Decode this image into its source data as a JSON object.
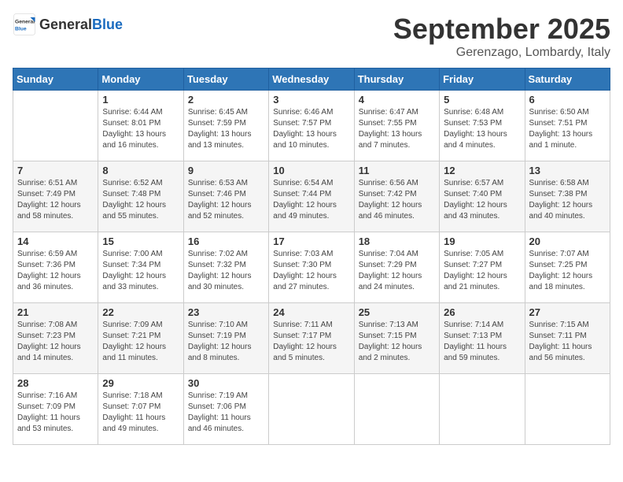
{
  "logo": {
    "general": "General",
    "blue": "Blue"
  },
  "title": "September 2025",
  "location": "Gerenzago, Lombardy, Italy",
  "weekdays": [
    "Sunday",
    "Monday",
    "Tuesday",
    "Wednesday",
    "Thursday",
    "Friday",
    "Saturday"
  ],
  "weeks": [
    [
      {
        "day": "",
        "sunrise": "",
        "sunset": "",
        "daylight": ""
      },
      {
        "day": "1",
        "sunrise": "Sunrise: 6:44 AM",
        "sunset": "Sunset: 8:01 PM",
        "daylight": "Daylight: 13 hours and 16 minutes."
      },
      {
        "day": "2",
        "sunrise": "Sunrise: 6:45 AM",
        "sunset": "Sunset: 7:59 PM",
        "daylight": "Daylight: 13 hours and 13 minutes."
      },
      {
        "day": "3",
        "sunrise": "Sunrise: 6:46 AM",
        "sunset": "Sunset: 7:57 PM",
        "daylight": "Daylight: 13 hours and 10 minutes."
      },
      {
        "day": "4",
        "sunrise": "Sunrise: 6:47 AM",
        "sunset": "Sunset: 7:55 PM",
        "daylight": "Daylight: 13 hours and 7 minutes."
      },
      {
        "day": "5",
        "sunrise": "Sunrise: 6:48 AM",
        "sunset": "Sunset: 7:53 PM",
        "daylight": "Daylight: 13 hours and 4 minutes."
      },
      {
        "day": "6",
        "sunrise": "Sunrise: 6:50 AM",
        "sunset": "Sunset: 7:51 PM",
        "daylight": "Daylight: 13 hours and 1 minute."
      }
    ],
    [
      {
        "day": "7",
        "sunrise": "Sunrise: 6:51 AM",
        "sunset": "Sunset: 7:49 PM",
        "daylight": "Daylight: 12 hours and 58 minutes."
      },
      {
        "day": "8",
        "sunrise": "Sunrise: 6:52 AM",
        "sunset": "Sunset: 7:48 PM",
        "daylight": "Daylight: 12 hours and 55 minutes."
      },
      {
        "day": "9",
        "sunrise": "Sunrise: 6:53 AM",
        "sunset": "Sunset: 7:46 PM",
        "daylight": "Daylight: 12 hours and 52 minutes."
      },
      {
        "day": "10",
        "sunrise": "Sunrise: 6:54 AM",
        "sunset": "Sunset: 7:44 PM",
        "daylight": "Daylight: 12 hours and 49 minutes."
      },
      {
        "day": "11",
        "sunrise": "Sunrise: 6:56 AM",
        "sunset": "Sunset: 7:42 PM",
        "daylight": "Daylight: 12 hours and 46 minutes."
      },
      {
        "day": "12",
        "sunrise": "Sunrise: 6:57 AM",
        "sunset": "Sunset: 7:40 PM",
        "daylight": "Daylight: 12 hours and 43 minutes."
      },
      {
        "day": "13",
        "sunrise": "Sunrise: 6:58 AM",
        "sunset": "Sunset: 7:38 PM",
        "daylight": "Daylight: 12 hours and 40 minutes."
      }
    ],
    [
      {
        "day": "14",
        "sunrise": "Sunrise: 6:59 AM",
        "sunset": "Sunset: 7:36 PM",
        "daylight": "Daylight: 12 hours and 36 minutes."
      },
      {
        "day": "15",
        "sunrise": "Sunrise: 7:00 AM",
        "sunset": "Sunset: 7:34 PM",
        "daylight": "Daylight: 12 hours and 33 minutes."
      },
      {
        "day": "16",
        "sunrise": "Sunrise: 7:02 AM",
        "sunset": "Sunset: 7:32 PM",
        "daylight": "Daylight: 12 hours and 30 minutes."
      },
      {
        "day": "17",
        "sunrise": "Sunrise: 7:03 AM",
        "sunset": "Sunset: 7:30 PM",
        "daylight": "Daylight: 12 hours and 27 minutes."
      },
      {
        "day": "18",
        "sunrise": "Sunrise: 7:04 AM",
        "sunset": "Sunset: 7:29 PM",
        "daylight": "Daylight: 12 hours and 24 minutes."
      },
      {
        "day": "19",
        "sunrise": "Sunrise: 7:05 AM",
        "sunset": "Sunset: 7:27 PM",
        "daylight": "Daylight: 12 hours and 21 minutes."
      },
      {
        "day": "20",
        "sunrise": "Sunrise: 7:07 AM",
        "sunset": "Sunset: 7:25 PM",
        "daylight": "Daylight: 12 hours and 18 minutes."
      }
    ],
    [
      {
        "day": "21",
        "sunrise": "Sunrise: 7:08 AM",
        "sunset": "Sunset: 7:23 PM",
        "daylight": "Daylight: 12 hours and 14 minutes."
      },
      {
        "day": "22",
        "sunrise": "Sunrise: 7:09 AM",
        "sunset": "Sunset: 7:21 PM",
        "daylight": "Daylight: 12 hours and 11 minutes."
      },
      {
        "day": "23",
        "sunrise": "Sunrise: 7:10 AM",
        "sunset": "Sunset: 7:19 PM",
        "daylight": "Daylight: 12 hours and 8 minutes."
      },
      {
        "day": "24",
        "sunrise": "Sunrise: 7:11 AM",
        "sunset": "Sunset: 7:17 PM",
        "daylight": "Daylight: 12 hours and 5 minutes."
      },
      {
        "day": "25",
        "sunrise": "Sunrise: 7:13 AM",
        "sunset": "Sunset: 7:15 PM",
        "daylight": "Daylight: 12 hours and 2 minutes."
      },
      {
        "day": "26",
        "sunrise": "Sunrise: 7:14 AM",
        "sunset": "Sunset: 7:13 PM",
        "daylight": "Daylight: 11 hours and 59 minutes."
      },
      {
        "day": "27",
        "sunrise": "Sunrise: 7:15 AM",
        "sunset": "Sunset: 7:11 PM",
        "daylight": "Daylight: 11 hours and 56 minutes."
      }
    ],
    [
      {
        "day": "28",
        "sunrise": "Sunrise: 7:16 AM",
        "sunset": "Sunset: 7:09 PM",
        "daylight": "Daylight: 11 hours and 53 minutes."
      },
      {
        "day": "29",
        "sunrise": "Sunrise: 7:18 AM",
        "sunset": "Sunset: 7:07 PM",
        "daylight": "Daylight: 11 hours and 49 minutes."
      },
      {
        "day": "30",
        "sunrise": "Sunrise: 7:19 AM",
        "sunset": "Sunset: 7:06 PM",
        "daylight": "Daylight: 11 hours and 46 minutes."
      },
      {
        "day": "",
        "sunrise": "",
        "sunset": "",
        "daylight": ""
      },
      {
        "day": "",
        "sunrise": "",
        "sunset": "",
        "daylight": ""
      },
      {
        "day": "",
        "sunrise": "",
        "sunset": "",
        "daylight": ""
      },
      {
        "day": "",
        "sunrise": "",
        "sunset": "",
        "daylight": ""
      }
    ]
  ]
}
